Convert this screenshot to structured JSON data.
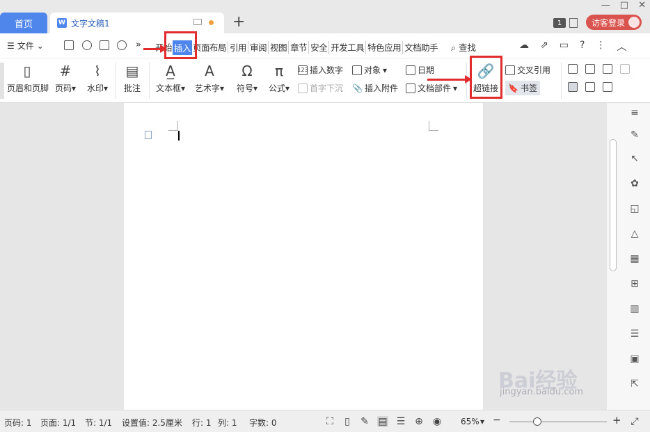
{
  "tabs": {
    "home": "首页",
    "doc": "文字文稿1",
    "add": "+"
  },
  "window": {
    "badge": "1",
    "login": "访客登录",
    "min": "—",
    "max": "□",
    "close": "✕"
  },
  "menu": {
    "file": "文件",
    "tabs": [
      "开始",
      "插入",
      "页面布局",
      "引用",
      "审阅",
      "视图",
      "章节",
      "安全",
      "开发工具",
      "特色应用",
      "文档助手"
    ],
    "active_tab": "插入",
    "find": "查找"
  },
  "ribbon": {
    "header_footer": "页眉和页脚",
    "page_number": "页码",
    "watermark": "水印",
    "comment": "批注",
    "textbox": "文本框",
    "wordart": "艺术字",
    "symbol": "符号",
    "formula": "公式",
    "insert_number": "插入数字",
    "object": "对象",
    "dropcap": "首字下沉",
    "attachment": "插入附件",
    "date": "日期",
    "doc_parts": "文档部件",
    "hyperlink": "超链接",
    "cross_ref": "交叉引用",
    "bookmark": "书签"
  },
  "status": {
    "page_no": "页码: 1",
    "pages": "页面: 1/1",
    "section": "节: 1/1",
    "setting": "设置值: 2.5厘米",
    "row": "行: 1",
    "col": "列: 1",
    "words": "字数: 0",
    "zoom": "65%"
  },
  "watermark": {
    "brand": "Bai经验",
    "url": "jingyan.baidu.com"
  },
  "colors": {
    "accent": "#4f86ec",
    "highlight": "#e02c2c",
    "login": "#d9534f"
  }
}
